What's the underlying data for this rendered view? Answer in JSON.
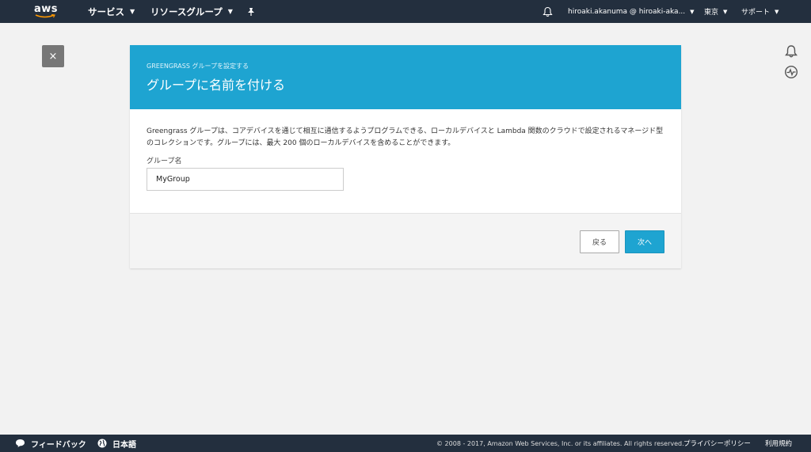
{
  "topnav": {
    "logo_text": "aws",
    "services_label": "サービス",
    "resource_groups_label": "リソースグループ",
    "pin_icon": "pin-icon",
    "bell_icon": "bell-icon",
    "account_label": "hiroaki.akanuma @ hiroaki-aka...",
    "region_label": "東京",
    "support_label": "サポート"
  },
  "close_button": {
    "label": "×"
  },
  "card": {
    "step_label": "GREENGRASS グループを設定する",
    "title": "グループに名前を付ける",
    "description": "Greengrass グループは、コアデバイスを通じて相互に通信するようプログラムできる、ローカルデバイスと Lambda 関数のクラウドで設定されるマネージド型のコレクションです。グループには、最大 200 個のローカルデバイスを含めることができます。",
    "field_label": "グループ名",
    "field_value": "MyGroup",
    "back_label": "戻る",
    "next_label": "次へ"
  },
  "footer": {
    "feedback_label": "フィードバック",
    "language_label": "日本語",
    "copyright": "© 2008 - 2017, Amazon Web Services, Inc. or its affiliates. All rights reserved.",
    "privacy_label": "プライバシーポリシー",
    "terms_label": "利用規約"
  },
  "colors": {
    "nav_bg": "#232f3e",
    "accent": "#1ea4d1",
    "page_bg": "#f2f2f2"
  }
}
